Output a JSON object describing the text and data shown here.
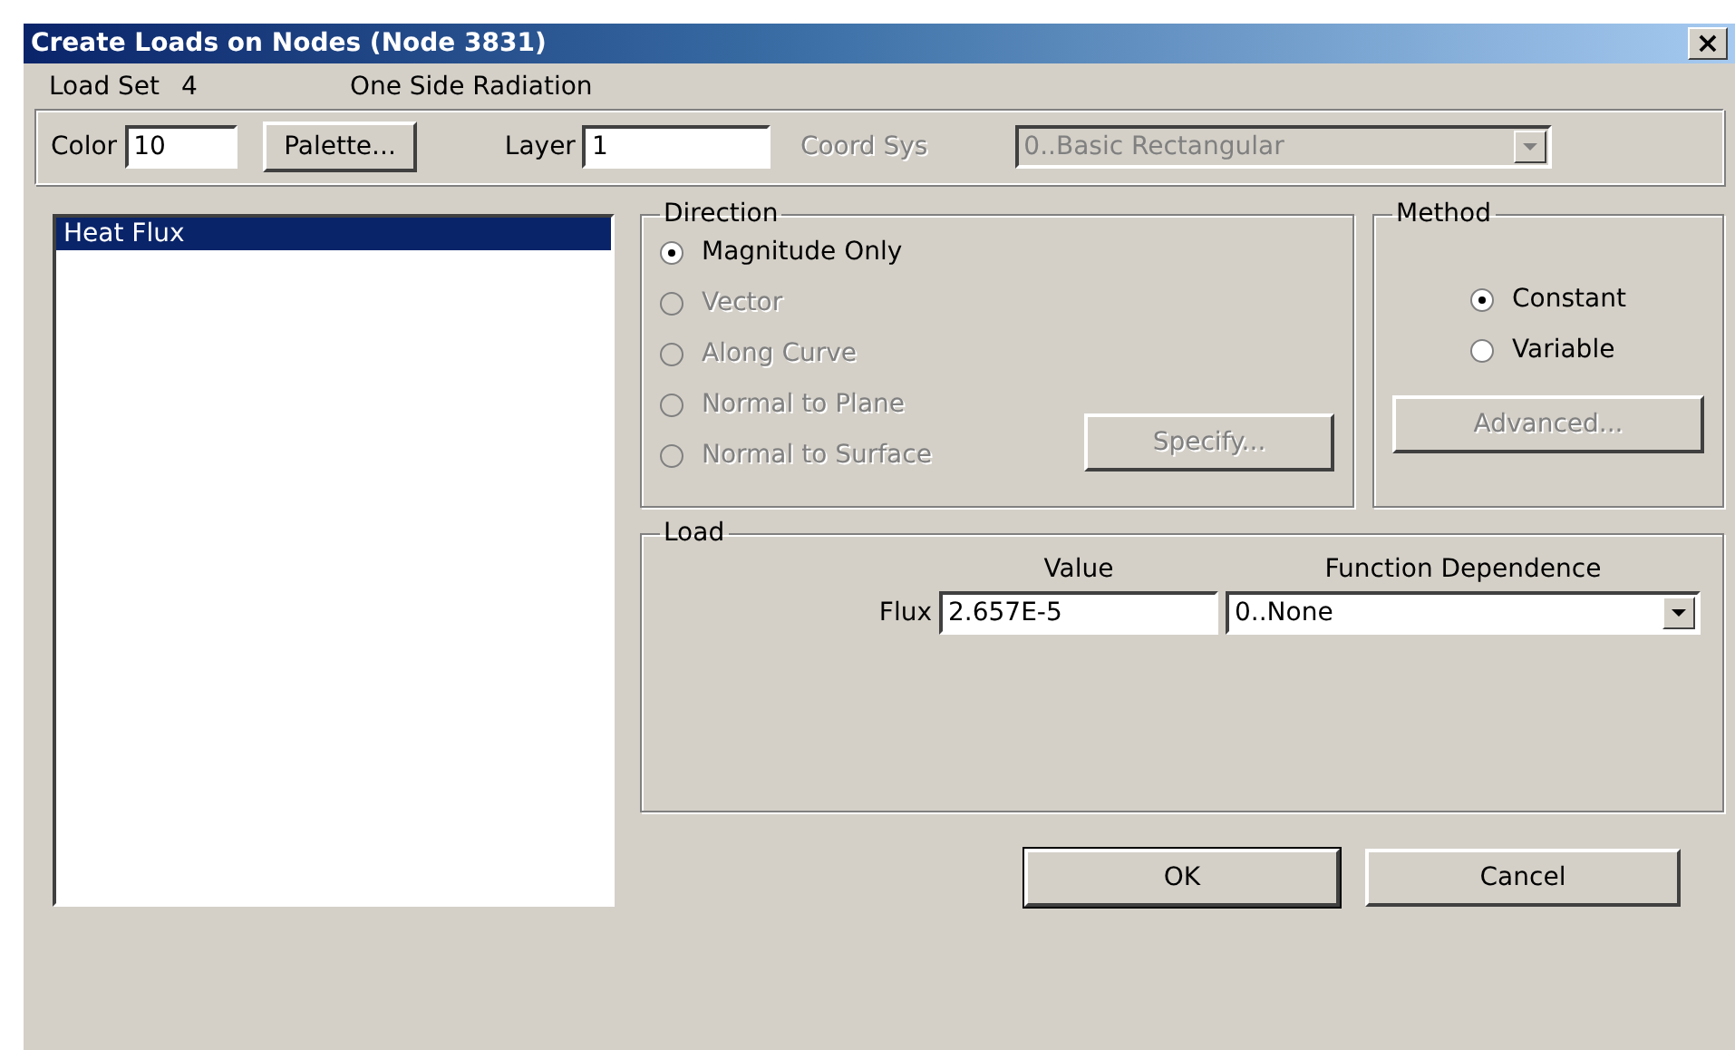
{
  "window": {
    "title": "Create Loads on Nodes (Node 3831)",
    "close": "×"
  },
  "header": {
    "load_set_label": "Load Set",
    "load_set_value": "4",
    "load_set_name": "One Side Radiation"
  },
  "toolbar": {
    "color_label": "Color",
    "color_value": "10",
    "palette_button": "Palette...",
    "layer_label": "Layer",
    "layer_value": "1",
    "coord_sys_label": "Coord Sys",
    "coord_sys_value": "0..Basic Rectangular",
    "coord_sys_disabled": true
  },
  "load_types": [
    {
      "label": "Heat Flux",
      "selected": true
    }
  ],
  "direction": {
    "title": "Direction",
    "options": [
      {
        "label": "Magnitude Only",
        "selected": true,
        "disabled": false
      },
      {
        "label": "Vector",
        "selected": false,
        "disabled": true
      },
      {
        "label": "Along Curve",
        "selected": false,
        "disabled": true
      },
      {
        "label": "Normal to Plane",
        "selected": false,
        "disabled": true
      },
      {
        "label": "Normal to Surface",
        "selected": false,
        "disabled": true
      }
    ],
    "specify_button": {
      "label": "Specify...",
      "disabled": true
    }
  },
  "method": {
    "title": "Method",
    "options": [
      {
        "label": "Constant",
        "selected": true,
        "disabled": false
      },
      {
        "label": "Variable",
        "selected": false,
        "disabled": false
      }
    ],
    "advanced_button": {
      "label": "Advanced...",
      "disabled": true
    }
  },
  "load": {
    "title": "Load",
    "value_header": "Value",
    "function_header": "Function Dependence",
    "row_label": "Flux",
    "value": "2.657E-5",
    "function_value": "0..None"
  },
  "buttons": [
    {
      "label": "OK",
      "default": true
    },
    {
      "label": "Cancel",
      "default": false
    }
  ]
}
